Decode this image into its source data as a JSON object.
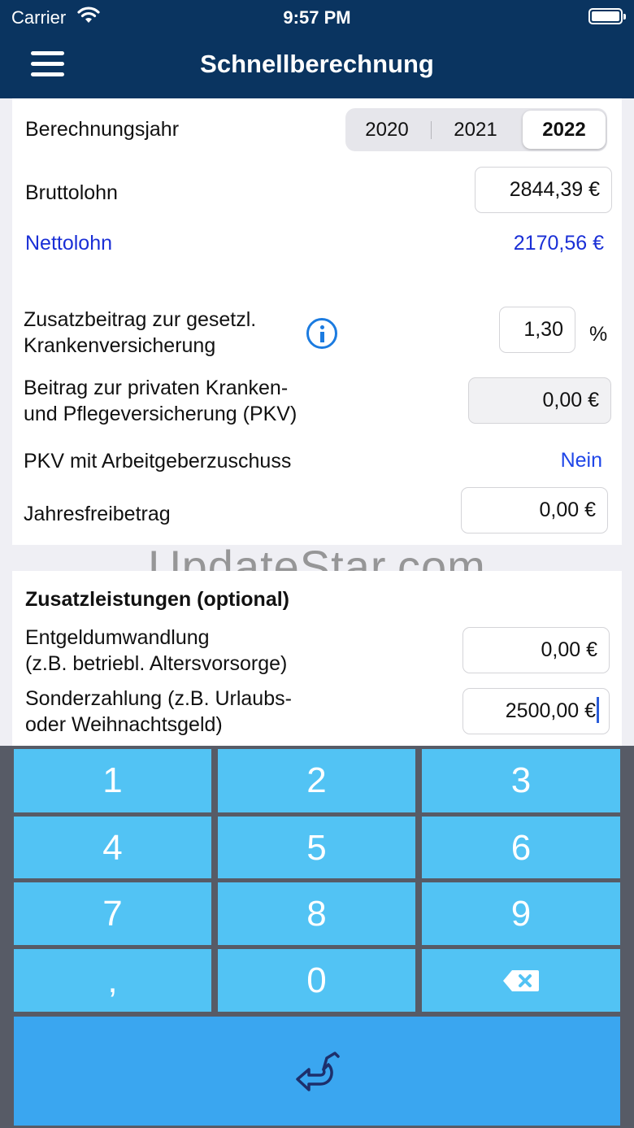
{
  "status_bar": {
    "carrier": "Carrier",
    "time": "9:57 PM"
  },
  "nav": {
    "title": "Schnellberechnung",
    "menu_icon": "hamburger-icon"
  },
  "main": {
    "year_label": "Berechnungsjahr",
    "years": [
      "2020",
      "2021",
      "2022"
    ],
    "selected_year": "2022",
    "gross_label": "Bruttolohn",
    "gross_value": "2844,39 €",
    "net_label": "Nettolohn",
    "net_value": "2170,56 €",
    "zusatz_label_line1": "Zusatzbeitrag zur gesetzl.",
    "zusatz_label_line2": "Krankenversicherung",
    "zusatz_value": "1,30",
    "zusatz_unit": "%",
    "pkv_label_line1": "Beitrag zur privaten Kranken-",
    "pkv_label_line2": "und Pflegeversicherung (PKV)",
    "pkv_value": "0,00 €",
    "pkv_employer_label": "PKV mit Arbeitgeberzuschuss",
    "pkv_employer_value": "Nein",
    "allowance_label": "Jahresfreibetrag",
    "allowance_value": "0,00 €"
  },
  "extras": {
    "heading": "Zusatzleistungen (optional)",
    "conversion_label_line1": "Entgeldumwandlung",
    "conversion_label_line2": "(z.B. betriebl. Altersvorsorge)",
    "conversion_value": "0,00 €",
    "special_label_line1": "Sonderzahlung (z.B. Urlaubs-",
    "special_label_line2": "oder Weihnachtsgeld)",
    "special_value": "2500,00 €"
  },
  "watermark": "UpdateStar.com",
  "keypad": {
    "keys": [
      "1",
      "2",
      "3",
      "4",
      "5",
      "6",
      "7",
      "8",
      "9",
      ",",
      "0"
    ],
    "backspace_icon": "backspace-icon",
    "enter_icon": "return-arrow-icon"
  },
  "colors": {
    "nav_background": "#0a3460",
    "link_blue": "#1a2fd6",
    "key_blue": "#52c3f4",
    "enter_blue": "#3aa6f0",
    "keypad_border": "#575b66"
  }
}
